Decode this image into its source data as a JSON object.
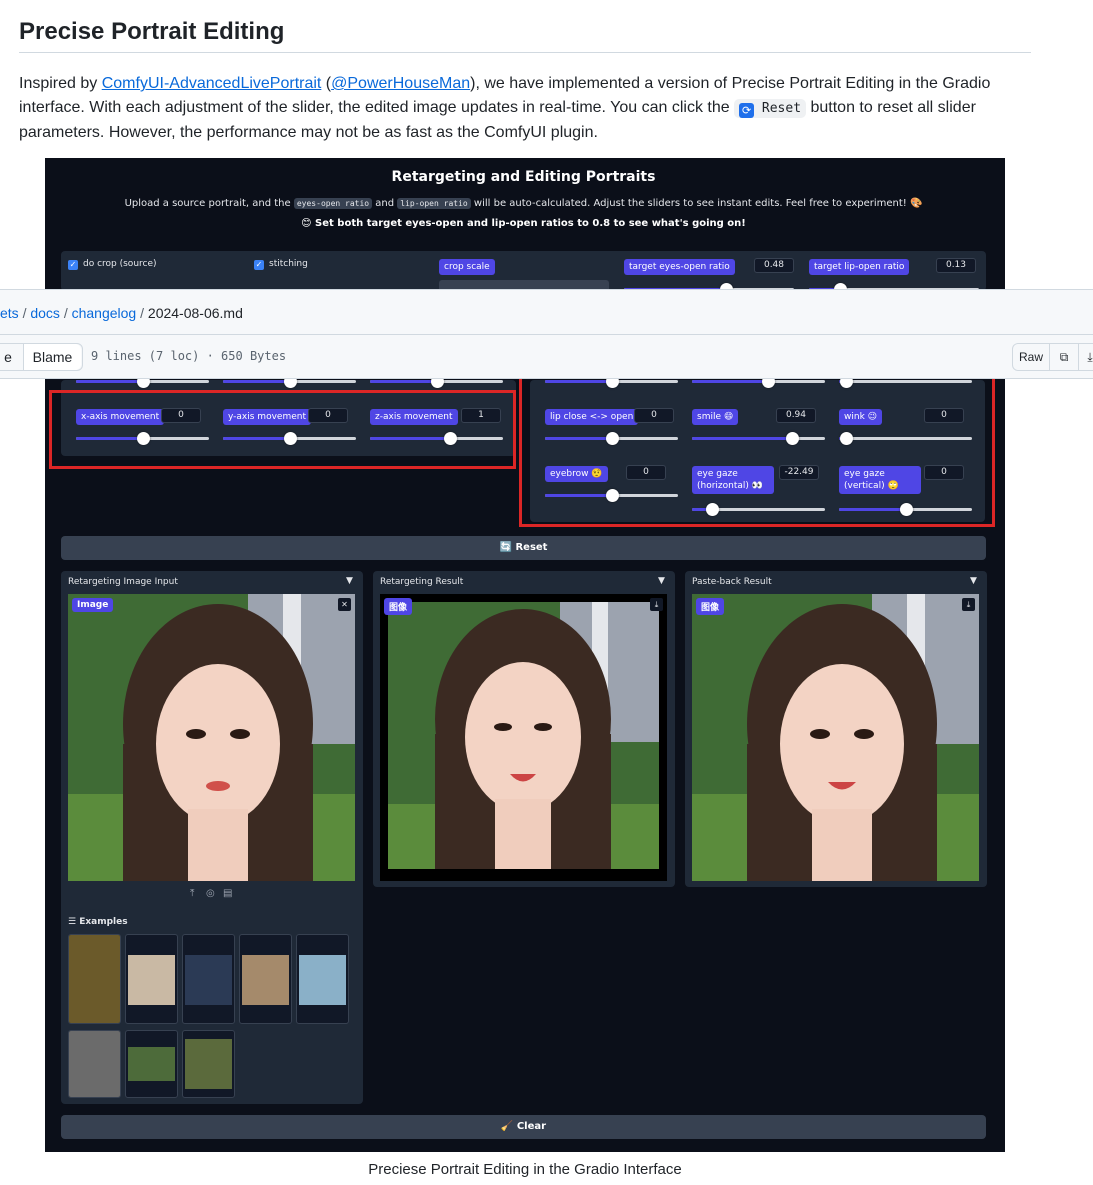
{
  "markdown": {
    "heading": "Precise Portrait Editing",
    "para_1": "Inspired by ",
    "link_1": "ComfyUI-AdvancedLivePortrait",
    "para_2": " (",
    "link_2": "@PowerHouseMan",
    "para_3": "), we have implemented a version of Precise Portrait Editing in the Gradio interface. With each adjustment of the slider, the edited image updates in real-time. You can click the ",
    "reset_code": "Reset",
    "para_4": " button to reset all slider parameters. However, the performance may not be as fast as the ComfyUI plugin.",
    "caption": "Preciese Portrait Editing in the Gradio Interface"
  },
  "gradio": {
    "title": "Retargeting and Editing Portraits",
    "intro_1": "Upload a source portrait, and the ",
    "code_eyes": "eyes-open ratio",
    "intro_2": " and ",
    "code_lip": "lip-open ratio",
    "intro_3": " will be auto-calculated. Adjust the sliders to see instant edits. Feel free to experiment! 🎨",
    "hint": "😊 Set both target eyes-open and lip-open ratios to 0.8 to see what's going on!",
    "checkbox_crop": "do crop (source)",
    "checkbox_stitch": "stitching",
    "crop_scale": "crop scale",
    "eyes_ratio": {
      "label": "target eyes-open ratio",
      "value": "0.48",
      "level": 0.6
    },
    "lip_ratio": {
      "label": "target lip-open ratio",
      "value": "0.13",
      "level": 0.18
    },
    "movement_sliders": [
      {
        "label": "x-axis movement",
        "value": "0",
        "level": 0.5
      },
      {
        "label": "y-axis movement",
        "value": "0",
        "level": 0.5
      },
      {
        "label": "z-axis movement",
        "value": "1",
        "level": 0.6
      }
    ],
    "expression_sliders": [
      {
        "label": "lip close <-> open",
        "value": "0",
        "level": 0.5
      },
      {
        "label": "smile 😄",
        "value": "0.94",
        "level": 0.75
      },
      {
        "label": "wink 😉",
        "value": "0",
        "level": 0.05
      },
      {
        "label": "eyebrow 🤨",
        "value": "0",
        "level": 0.5
      },
      {
        "label": "eye gaze (horizontal) 👀",
        "value": "-22.49",
        "level": 0.15
      },
      {
        "label": "eye gaze (vertical) 🙄",
        "value": "0",
        "level": 0.5
      }
    ],
    "reset_button": "🔄 Reset",
    "input_label": "Retargeting Image Input",
    "result_label": "Retargeting Result",
    "paste_label": "Paste-back Result",
    "tag_image": "Image",
    "tag_image_cn": "图像",
    "examples_label": "☰ Examples",
    "clear_button": "🧹 Clear"
  },
  "github": {
    "crumb_1": "ets",
    "crumb_2": "docs",
    "crumb_3": "changelog",
    "file": "2024-08-06.md",
    "tab_preview": "e",
    "tab_blame": "Blame",
    "info": "9 lines (7 loc) · 650 Bytes",
    "raw": "Raw"
  },
  "colors": {
    "accent": "#4f46e5",
    "highlight": "#dc2626",
    "link": "#0969da",
    "gradio_bg": "#0b0f19"
  }
}
